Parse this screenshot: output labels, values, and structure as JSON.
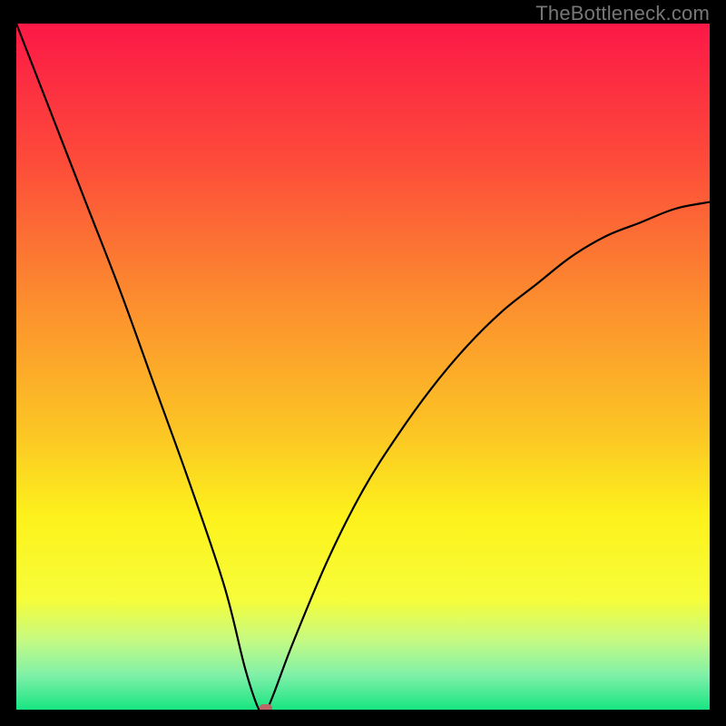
{
  "watermark": "TheBottleneck.com",
  "chart_data": {
    "type": "line",
    "title": "",
    "xlabel": "",
    "ylabel": "",
    "xlim": [
      0,
      100
    ],
    "ylim": [
      0,
      100
    ],
    "x": [
      0,
      5,
      10,
      15,
      20,
      25,
      30,
      33,
      35,
      36,
      37,
      40,
      45,
      50,
      55,
      60,
      65,
      70,
      75,
      80,
      85,
      90,
      95,
      100
    ],
    "values": [
      100,
      87,
      74,
      61,
      47,
      33,
      18,
      6,
      0,
      0,
      2,
      10,
      22,
      32,
      40,
      47,
      53,
      58,
      62,
      66,
      69,
      71,
      73,
      74
    ],
    "background_gradient": {
      "stops": [
        {
          "pos": 0.0,
          "color": "#fc1847"
        },
        {
          "pos": 0.2,
          "color": "#fd4b3a"
        },
        {
          "pos": 0.4,
          "color": "#fc8c2f"
        },
        {
          "pos": 0.6,
          "color": "#fcc724"
        },
        {
          "pos": 0.72,
          "color": "#fdf21c"
        },
        {
          "pos": 0.84,
          "color": "#f6fd3a"
        },
        {
          "pos": 0.9,
          "color": "#c4fa84"
        },
        {
          "pos": 0.95,
          "color": "#7ff0a8"
        },
        {
          "pos": 1.0,
          "color": "#18e582"
        }
      ]
    },
    "marker": {
      "x": 36,
      "y": 0
    },
    "grid": false,
    "legend": false
  }
}
